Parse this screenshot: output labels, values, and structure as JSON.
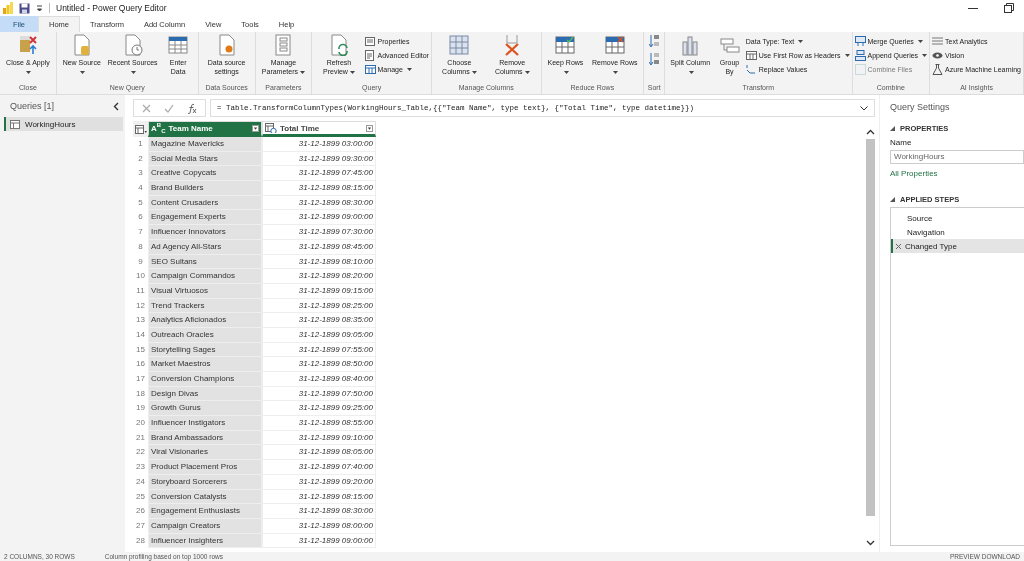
{
  "window": {
    "title": "Untitled - Power Query Editor"
  },
  "tabs": [
    {
      "label": "File",
      "kind": "file",
      "selected": false
    },
    {
      "label": "Home",
      "kind": "tab",
      "selected": true
    },
    {
      "label": "Transform",
      "kind": "tab",
      "selected": false
    },
    {
      "label": "Add Column",
      "kind": "tab",
      "selected": false
    },
    {
      "label": "View",
      "kind": "tab",
      "selected": false
    },
    {
      "label": "Tools",
      "kind": "tab",
      "selected": false
    },
    {
      "label": "Help",
      "kind": "tab",
      "selected": false
    }
  ],
  "ribbon": [
    {
      "label": "Close",
      "items": [
        {
          "kind": "large",
          "label": "Close & Apply",
          "dropdown": true,
          "disabled": false
        }
      ]
    },
    {
      "label": "New Query",
      "items": [
        {
          "kind": "large",
          "label": "New Source",
          "dropdown": true,
          "disabled": false
        },
        {
          "kind": "large",
          "label": "Recent Sources",
          "dropdown": true,
          "disabled": false
        },
        {
          "kind": "large",
          "label": "Enter Data",
          "dropdown": false,
          "disabled": false
        }
      ]
    },
    {
      "label": "Data Sources",
      "items": [
        {
          "kind": "large",
          "label": "Data source settings",
          "dropdown": false,
          "disabled": false
        }
      ]
    },
    {
      "label": "Parameters",
      "items": [
        {
          "kind": "large",
          "label": "Manage Parameters",
          "dropdown": true,
          "disabled": false
        }
      ]
    },
    {
      "label": "Query",
      "items": [
        {
          "kind": "large",
          "label": "Refresh Preview",
          "dropdown": true,
          "disabled": false
        },
        {
          "kind": "small",
          "label": "Properties",
          "dropdown": false,
          "disabled": false
        },
        {
          "kind": "small",
          "label": "Advanced Editor",
          "dropdown": false,
          "disabled": false
        },
        {
          "kind": "small",
          "label": "Manage",
          "dropdown": true,
          "disabled": false
        }
      ]
    },
    {
      "label": "Manage Columns",
      "items": [
        {
          "kind": "large",
          "label": "Choose Columns",
          "dropdown": true,
          "disabled": false
        },
        {
          "kind": "large",
          "label": "Remove Columns",
          "dropdown": true,
          "disabled": false
        }
      ]
    },
    {
      "label": "Reduce Rows",
      "items": [
        {
          "kind": "large",
          "label": "Keep Rows",
          "dropdown": true,
          "disabled": false
        },
        {
          "kind": "large",
          "label": "Remove Rows",
          "dropdown": true,
          "disabled": false
        }
      ]
    },
    {
      "label": "Sort",
      "items": [
        {
          "kind": "sort",
          "disabled": false
        }
      ]
    },
    {
      "label": "Transform",
      "items": [
        {
          "kind": "large",
          "label": "Split Column",
          "dropdown": true,
          "disabled": false
        },
        {
          "kind": "large",
          "label": "Group By",
          "dropdown": false,
          "disabled": false
        },
        {
          "kind": "small",
          "label": "Data Type: Text",
          "dropdown": true,
          "disabled": false
        },
        {
          "kind": "small",
          "label": "Use First Row as Headers",
          "dropdown": true,
          "disabled": false
        },
        {
          "kind": "small",
          "label": "Replace Values",
          "dropdown": false,
          "disabled": false
        }
      ]
    },
    {
      "label": "Combine",
      "items": [
        {
          "kind": "small",
          "label": "Merge Queries",
          "dropdown": true,
          "disabled": false
        },
        {
          "kind": "small",
          "label": "Append Queries",
          "dropdown": true,
          "disabled": false
        },
        {
          "kind": "small",
          "label": "Combine Files",
          "dropdown": false,
          "disabled": true
        }
      ]
    },
    {
      "label": "AI Insights",
      "items": [
        {
          "kind": "small",
          "label": "Text Analytics",
          "dropdown": false,
          "disabled": false
        },
        {
          "kind": "small",
          "label": "Vision",
          "dropdown": false,
          "disabled": false
        },
        {
          "kind": "small",
          "label": "Azure Machine Learning",
          "dropdown": false,
          "disabled": false
        }
      ]
    }
  ],
  "queries": {
    "title": "Queries [1]",
    "items": [
      {
        "label": "WorkingHours",
        "selected": true
      }
    ]
  },
  "formula": "= Table.TransformColumnTypes(WorkingHours_Table,{{\"Team Name\", type text}, {\"Total Time\", type datetime}})",
  "table": {
    "columns": [
      {
        "name": "Team Name",
        "kind": "text",
        "icon_text": "A$^{B}$$_{C}$",
        "selected": true
      },
      {
        "name": "Total Time",
        "kind": "datetime",
        "selected": false
      }
    ],
    "rows": [
      {
        "number": "1",
        "cells": [
          "Magazine Mavericks",
          "31-12-1899 03:00:00"
        ]
      },
      {
        "number": "2",
        "cells": [
          "Social Media Stars",
          "31-12-1899 09:30:00"
        ]
      },
      {
        "number": "3",
        "cells": [
          "Creative Copycats",
          "31-12-1899 07:45:00"
        ]
      },
      {
        "number": "4",
        "cells": [
          "Brand Builders",
          "31-12-1899 08:15:00"
        ]
      },
      {
        "number": "5",
        "cells": [
          "Content Crusaders",
          "31-12-1899 08:30:00"
        ]
      },
      {
        "number": "6",
        "cells": [
          "Engagement Experts",
          "31-12-1899 09:00:00"
        ]
      },
      {
        "number": "7",
        "cells": [
          "Influencer Innovators",
          "31-12-1899 07:30:00"
        ]
      },
      {
        "number": "8",
        "cells": [
          "Ad Agency All-Stars",
          "31-12-1899 08:45:00"
        ]
      },
      {
        "number": "9",
        "cells": [
          "SEO Sultans",
          "31-12-1899 08:10:00"
        ]
      },
      {
        "number": "10",
        "cells": [
          "Campaign Commandos",
          "31-12-1899 08:20:00"
        ]
      },
      {
        "number": "11",
        "cells": [
          "Visual Virtuosos",
          "31-12-1899 09:15:00"
        ]
      },
      {
        "number": "12",
        "cells": [
          "Trend Trackers",
          "31-12-1899 08:25:00"
        ]
      },
      {
        "number": "13",
        "cells": [
          "Analytics Aficionados",
          "31-12-1899 08:35:00"
        ]
      },
      {
        "number": "14",
        "cells": [
          "Outreach Oracles",
          "31-12-1899 09:05:00"
        ]
      },
      {
        "number": "15",
        "cells": [
          "Storytelling Sages",
          "31-12-1899 07:55:00"
        ]
      },
      {
        "number": "16",
        "cells": [
          "Market Maestros",
          "31-12-1899 08:50:00"
        ]
      },
      {
        "number": "17",
        "cells": [
          "Conversion Champions",
          "31-12-1899 08:40:00"
        ]
      },
      {
        "number": "18",
        "cells": [
          "Design Divas",
          "31-12-1899 07:50:00"
        ]
      },
      {
        "number": "19",
        "cells": [
          "Growth Gurus",
          "31-12-1899 09:25:00"
        ]
      },
      {
        "number": "20",
        "cells": [
          "Influencer Instigators",
          "31-12-1899 08:55:00"
        ]
      },
      {
        "number": "21",
        "cells": [
          "Brand Ambassadors",
          "31-12-1899 09:10:00"
        ]
      },
      {
        "number": "22",
        "cells": [
          "Viral Visionaries",
          "31-12-1899 08:05:00"
        ]
      },
      {
        "number": "23",
        "cells": [
          "Product Placement Pros",
          "31-12-1899 07:40:00"
        ]
      },
      {
        "number": "24",
        "cells": [
          "Storyboard Sorcerers",
          "31-12-1899 09:20:00"
        ]
      },
      {
        "number": "25",
        "cells": [
          "Conversion Catalysts",
          "31-12-1899 08:15:00"
        ]
      },
      {
        "number": "26",
        "cells": [
          "Engagement Enthusiasts",
          "31-12-1899 08:30:00"
        ]
      },
      {
        "number": "27",
        "cells": [
          "Campaign Creators",
          "31-12-1899 08:00:00"
        ]
      },
      {
        "number": "28",
        "cells": [
          "Influencer Insighters",
          "31-12-1899 09:00:00"
        ]
      }
    ]
  },
  "settings": {
    "title": "Query Settings",
    "properties": {
      "heading": "PROPERTIES",
      "name_label": "Name",
      "name_value": "WorkingHours",
      "link": "All Properties"
    },
    "steps_heading": "APPLIED STEPS",
    "steps": [
      {
        "label": "Source",
        "selected": false
      },
      {
        "label": "Navigation",
        "selected": false
      },
      {
        "label": "Changed Type",
        "selected": true
      }
    ]
  },
  "status_bar": {
    "left": "2 COLUMNS, 30 ROWS",
    "middle": "Column profiling based on top 1000 rows",
    "right": "PREVIEW DOWNLOAD"
  }
}
